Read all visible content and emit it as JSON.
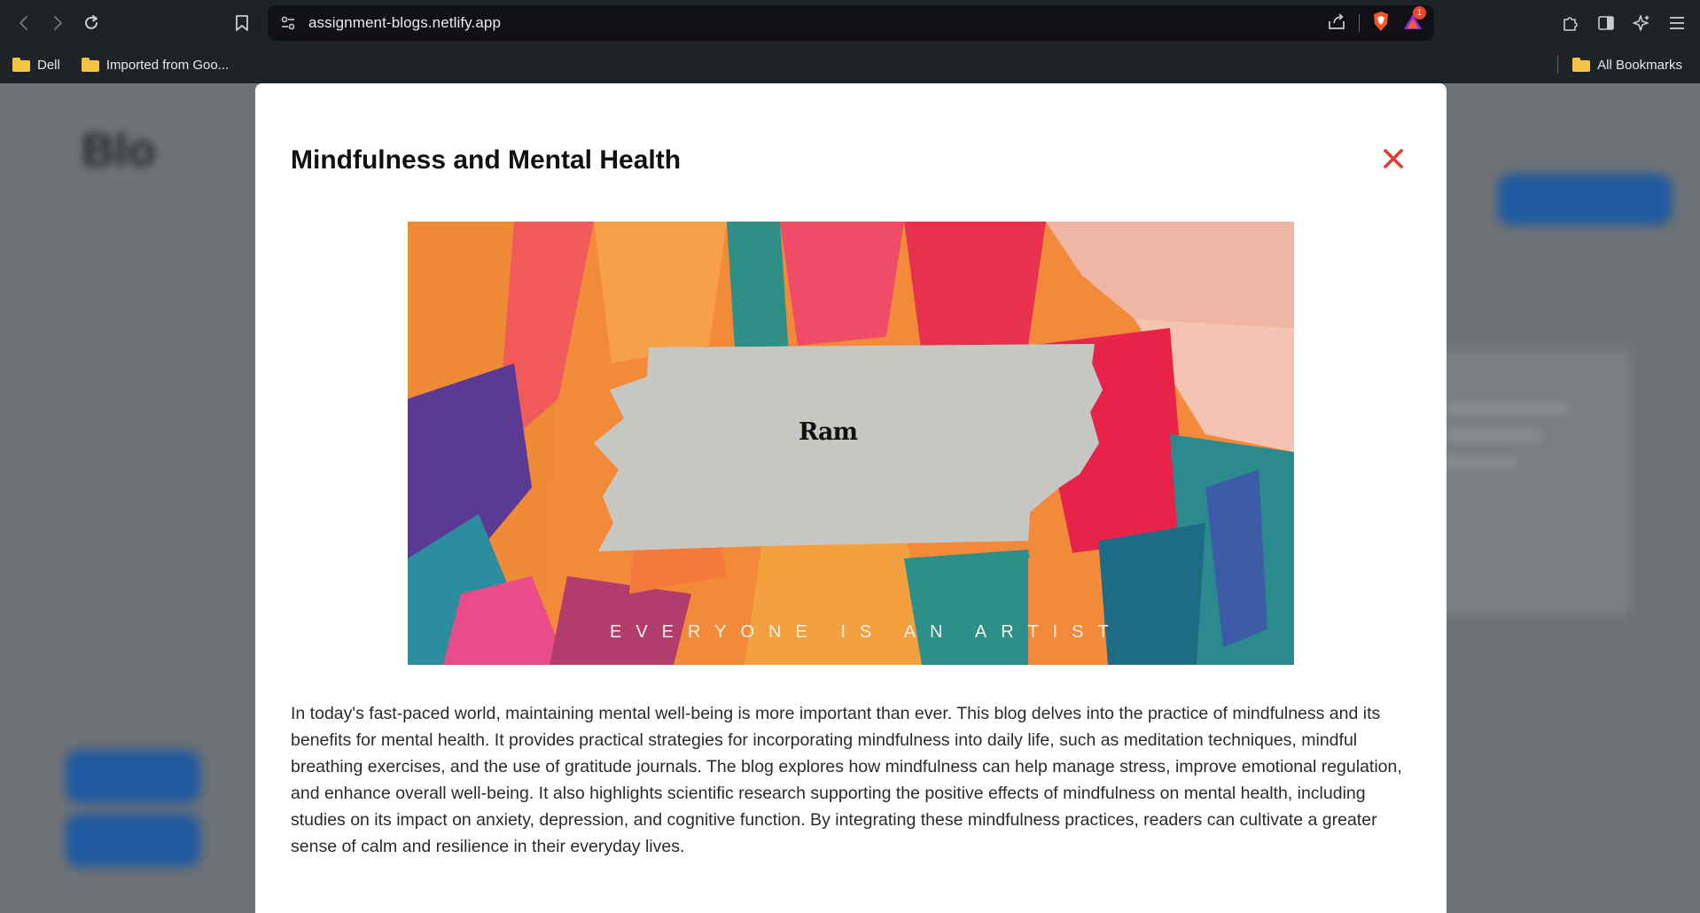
{
  "browser": {
    "url": "assignment-blogs.netlify.app",
    "brave_badge_count": "1",
    "bookmarks": [
      {
        "label": "Dell"
      },
      {
        "label": "Imported from Goo..."
      }
    ],
    "all_bookmarks_label": "All Bookmarks",
    "icons": {
      "back": "back-arrow-icon",
      "forward": "forward-arrow-icon",
      "reload": "reload-icon",
      "bookmark": "bookmark-icon",
      "site_info": "site-settings-icon",
      "share": "share-icon",
      "brave": "brave-shields-icon",
      "rewards": "brave-rewards-icon",
      "extensions": "extensions-icon",
      "sidebar": "sidebar-icon",
      "leo": "leo-ai-icon",
      "menu": "menu-icon"
    }
  },
  "modal": {
    "title": "Mindfulness and Mental Health",
    "close_icon": "close-icon",
    "close_color": "#e53935",
    "image": {
      "name_text": "Ram",
      "tagline": "EVERYONE IS AN ARTIST"
    },
    "body": "In today's fast-paced world, maintaining mental well-being is more important than ever. This blog delves into the practice of mindfulness and its benefits for mental health. It provides practical strategies for incorporating mindfulness into daily life, such as meditation techniques, mindful breathing exercises, and the use of gratitude journals. The blog explores how mindfulness can help manage stress, improve emotional regulation, and enhance overall well-being. It also highlights scientific research supporting the positive effects of mindfulness on mental health, including studies on its impact on anxiety, depression, and cognitive function. By integrating these mindfulness practices, readers can cultivate a greater sense of calm and resilience in their everyday lives."
  },
  "colors": {
    "accent_blue": "#1f5aa0",
    "overlay": "#6f7276",
    "chrome": "#1f2226"
  }
}
